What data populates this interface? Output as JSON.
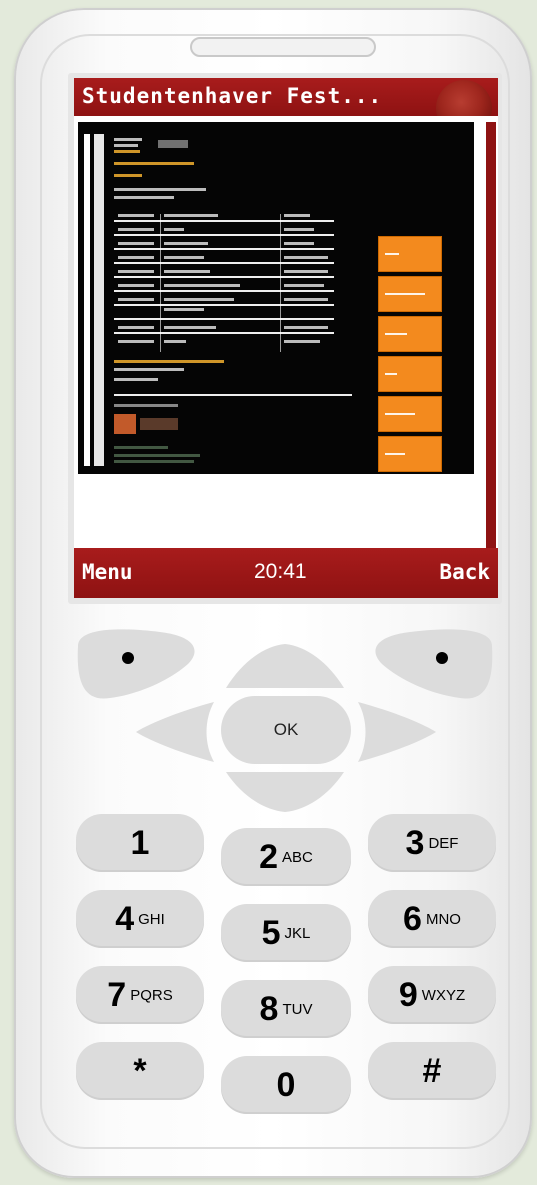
{
  "screen": {
    "title": "Studentenhaver Fest...",
    "softkeys": {
      "left": "Menu",
      "clock": "20:41",
      "right": "Back"
    }
  },
  "keypad": {
    "ok": "OK",
    "keys": [
      {
        "digit": "1",
        "letters": ""
      },
      {
        "digit": "2",
        "letters": "ABC"
      },
      {
        "digit": "3",
        "letters": "DEF"
      },
      {
        "digit": "4",
        "letters": "GHI"
      },
      {
        "digit": "5",
        "letters": "JKL"
      },
      {
        "digit": "6",
        "letters": "MNO"
      },
      {
        "digit": "7",
        "letters": "PQRS"
      },
      {
        "digit": "8",
        "letters": "TUV"
      },
      {
        "digit": "9",
        "letters": "WXYZ"
      },
      {
        "digit": "*",
        "letters": ""
      },
      {
        "digit": "0",
        "letters": ""
      },
      {
        "digit": "#",
        "letters": ""
      }
    ]
  },
  "icons": {
    "left_softkey": "dot-icon",
    "right_softkey": "dot-icon",
    "dpad_up": "arrow-up-icon",
    "dpad_down": "arrow-down-icon",
    "dpad_left": "arrow-left-icon",
    "dpad_right": "arrow-right-icon"
  },
  "colors": {
    "brand_red": "#9a1616",
    "orange_nav": "#f38a1e",
    "key_grey": "#dcdcdc",
    "background": "#e3eadb"
  }
}
